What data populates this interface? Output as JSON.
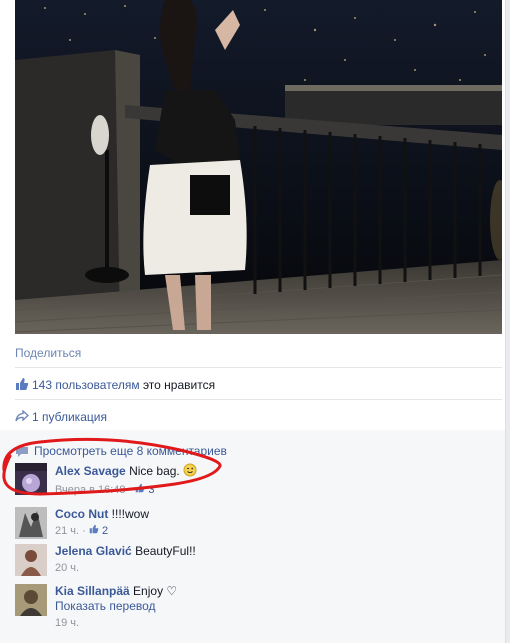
{
  "actions": {
    "share_label": "Поделиться"
  },
  "likes": {
    "count": "143 пользователям",
    "suffix": " это нравится"
  },
  "shares": {
    "text": "1 публикация"
  },
  "comments": {
    "view_more": "Просмотреть еще 8 комментариев",
    "items": [
      {
        "author": "Alex Savage",
        "text": "Nice bag.",
        "emoji": "wink",
        "time": "Вчера в 16:48",
        "likes": "3"
      },
      {
        "author": "Coco Nut",
        "text": "!!!!wow",
        "time": "21 ч.",
        "likes": "2"
      },
      {
        "author": "Jelena Glavić",
        "text": "BeautyFul!!",
        "time": "20 ч."
      },
      {
        "author": "Kia Sillanpää",
        "text": "Enjoy ♡",
        "translate": "Показать перевод",
        "time": "19 ч."
      }
    ]
  },
  "colors": {
    "link": "#3b5998",
    "meta": "#90949c",
    "annotation": "#e0191b"
  }
}
